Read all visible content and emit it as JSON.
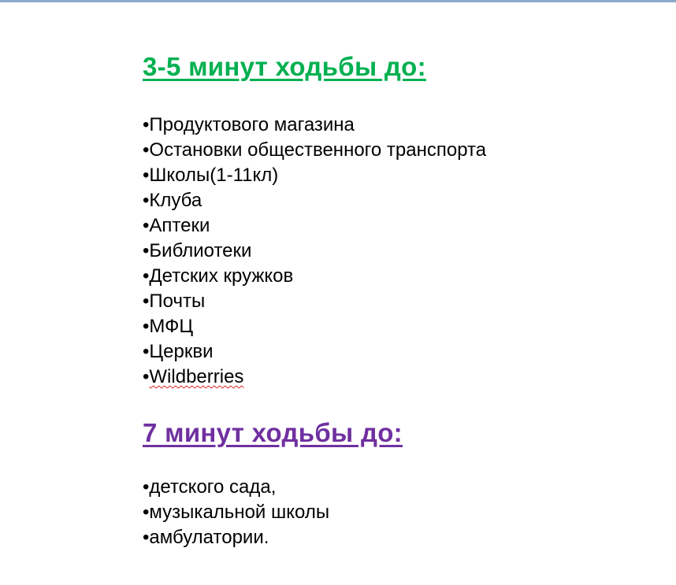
{
  "colors": {
    "heading_a": "#00b050",
    "heading_b": "#7030a0",
    "text": "#000000",
    "top_border": "#8eaacb",
    "spellcheck": "#e02020"
  },
  "bullet": "•",
  "section_a": {
    "heading": "3-5 минут ходьбы до:",
    "items": [
      "Продуктового магазина",
      "Остановки общественного транспорта",
      "Школы(1-11кл)",
      "Клуба",
      "Аптеки",
      "Библиотеки",
      "Детских кружков",
      "Почты",
      "МФЦ",
      "Церкви",
      "Wildberries"
    ]
  },
  "section_b": {
    "heading": "7 минут ходьбы до:",
    "items": [
      "детского сада,",
      "музыкальной школы",
      "амбулатории."
    ]
  }
}
